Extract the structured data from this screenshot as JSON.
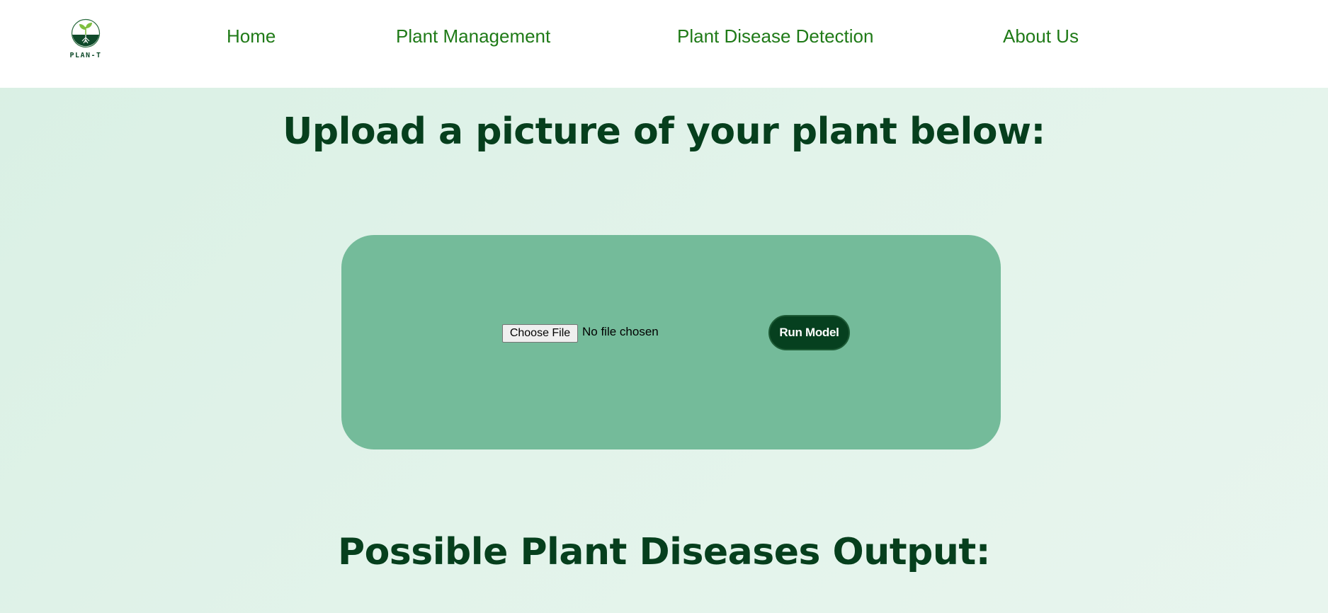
{
  "brand": {
    "logo_text": "PLAN-T"
  },
  "nav": {
    "home": "Home",
    "plant_management": "Plant Management",
    "plant_disease_detection": "Plant Disease Detection",
    "about_us": "About Us"
  },
  "upload_section": {
    "heading": "Upload a picture of your plant below:",
    "choose_file_label": "Choose File",
    "file_status": "No file chosen",
    "run_button_label": "Run Model"
  },
  "output_section": {
    "heading": "Possible Plant Diseases Output:"
  },
  "colors": {
    "nav_link": "#1f7a17",
    "heading": "#063f1d",
    "card": "#74bb9a",
    "run_button": "#06401f"
  }
}
